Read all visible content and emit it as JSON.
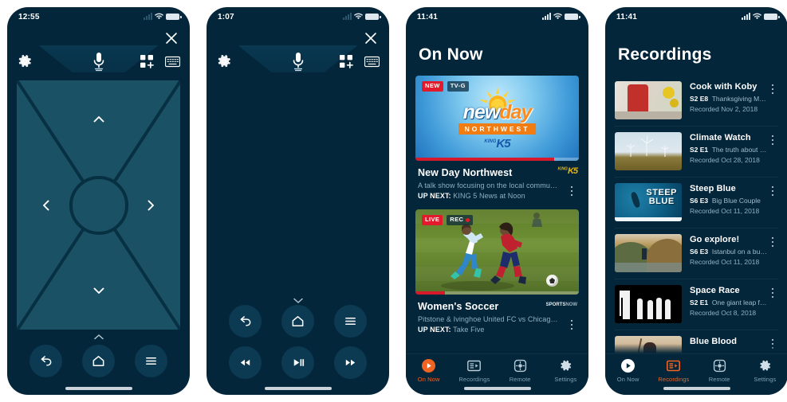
{
  "app": {
    "accent_orange": "#f06422",
    "bg_dark": "#04263a",
    "dpad_fill": "#1b5164",
    "red": "#e21b2c"
  },
  "panels": [
    {
      "id": "remote-dpad",
      "status": {
        "time": "12:55",
        "wifi": "wifi-icon",
        "battery": "battery-icon",
        "signal": "cell-signal-icon"
      },
      "header": {
        "close_label": "close-icon",
        "settings_label": "gear-icon",
        "mic_label": "microphone-icon",
        "keypad_label": "grid-keypad-icon",
        "keyboard_label": "keyboard-icon"
      },
      "dpad": {
        "up": "chevron-up-icon",
        "down": "chevron-down-icon",
        "left": "chevron-left-icon",
        "right": "chevron-right-icon",
        "ok": "ok-center-button"
      },
      "handle": "chevron-up-icon",
      "controls": [
        {
          "name": "back-button",
          "icon": "back-arrow-icon"
        },
        {
          "name": "home-button",
          "icon": "home-icon"
        },
        {
          "name": "menu-button",
          "icon": "hamburger-menu-icon"
        }
      ]
    },
    {
      "id": "remote-playback",
      "status": {
        "time": "1:07",
        "wifi": "wifi-icon",
        "battery": "battery-icon",
        "signal": "cell-signal-icon"
      },
      "header": {
        "close_label": "close-icon",
        "settings_label": "gear-icon",
        "mic_label": "microphone-icon",
        "keypad_label": "grid-keypad-icon",
        "keyboard_label": "keyboard-icon"
      },
      "handle": "chevron-down-icon",
      "controls_row1": [
        {
          "name": "back-button",
          "icon": "back-arrow-icon"
        },
        {
          "name": "home-button",
          "icon": "home-icon"
        },
        {
          "name": "menu-button",
          "icon": "hamburger-menu-icon"
        }
      ],
      "controls_row2": [
        {
          "name": "rewind-button",
          "icon": "rewind-icon"
        },
        {
          "name": "play-pause-button",
          "icon": "play-pause-icon"
        },
        {
          "name": "fast-forward-button",
          "icon": "fast-forward-icon"
        }
      ]
    },
    {
      "id": "on-now",
      "status": {
        "time": "11:41",
        "wifi": "wifi-icon",
        "battery": "battery-icon",
        "signal": "cell-signal-icon"
      },
      "title": "On Now",
      "cards": [
        {
          "badges": [
            {
              "text": "NEW",
              "style": "new"
            },
            {
              "text": "TV-G",
              "style": "tvg"
            }
          ],
          "artwork": "new-day-northwest-logo",
          "art_text": {
            "word_light": "new",
            "word_accent": "day",
            "strip": "NORTHWEST",
            "station": "KING5"
          },
          "progress_percent": 85,
          "title": "New Day Northwest",
          "subtitle": "A talk show focusing on the local community...",
          "up_next_label": "UP NEXT:",
          "up_next_value": "KING 5 News at Noon",
          "network_logo": "KING5",
          "menu": "kebab-menu-icon"
        },
        {
          "badges": [
            {
              "text": "LIVE",
              "style": "live"
            },
            {
              "text": "REC",
              "style": "rec"
            }
          ],
          "artwork": "womens-soccer-photo",
          "progress_percent": 18,
          "title": "Women's Soccer",
          "subtitle": "Pitstone & Ivinghoe United FC vs Chicago Red...",
          "up_next_label": "UP NEXT:",
          "up_next_value": "Take Five",
          "network_logo": "SPORTSNOW",
          "menu": "kebab-menu-icon"
        }
      ],
      "tabs": [
        {
          "label": "On Now",
          "icon": "play-circle-icon",
          "active": true
        },
        {
          "label": "Recordings",
          "icon": "recordings-list-icon",
          "active": false
        },
        {
          "label": "Remote",
          "icon": "remote-dpad-icon",
          "active": false
        },
        {
          "label": "Settings",
          "icon": "gear-icon",
          "active": false
        }
      ]
    },
    {
      "id": "recordings",
      "status": {
        "time": "11:41",
        "wifi": "wifi-icon",
        "battery": "battery-icon",
        "signal": "cell-signal-icon"
      },
      "title": "Recordings",
      "rows": [
        {
          "thumb": "cook-with-koby-thumb",
          "title": "Cook with Koby",
          "episode": "S2 E8",
          "episode_title": "Thanksgiving Menu",
          "recorded": "Recorded Nov 2, 2018",
          "menu": "kebab-menu-icon"
        },
        {
          "thumb": "climate-watch-thumb",
          "title": "Climate Watch",
          "episode": "S2 E1",
          "episode_title": "The truth about wind",
          "recorded": "Recorded Oct 28, 2018",
          "menu": "kebab-menu-icon"
        },
        {
          "thumb": "steep-blue-thumb",
          "title": "Steep Blue",
          "episode": "S6 E3",
          "episode_title": "Big Blue Couple",
          "recorded": "Recorded Oct 11, 2018",
          "menu": "kebab-menu-icon"
        },
        {
          "thumb": "go-explore-thumb",
          "title": "Go explore!",
          "episode": "S6 E3",
          "episode_title": "Istanbul on a budget",
          "recorded": "Recorded Oct 11, 2018",
          "menu": "kebab-menu-icon"
        },
        {
          "thumb": "space-race-thumb",
          "title": "Space Race",
          "episode": "S2 E1",
          "episode_title": "One giant leap for...",
          "recorded": "Recorded Oct 8, 2018",
          "menu": "kebab-menu-icon"
        },
        {
          "thumb": "blue-blood-thumb",
          "title": "Blue Blood",
          "episode": "",
          "episode_title": "",
          "recorded": "",
          "menu": "kebab-menu-icon"
        }
      ],
      "tabs": [
        {
          "label": "On Now",
          "icon": "play-circle-icon",
          "active": false
        },
        {
          "label": "Recordings",
          "icon": "recordings-list-icon",
          "active": true
        },
        {
          "label": "Remote",
          "icon": "remote-dpad-icon",
          "active": false
        },
        {
          "label": "Settings",
          "icon": "gear-icon",
          "active": false
        }
      ]
    }
  ]
}
